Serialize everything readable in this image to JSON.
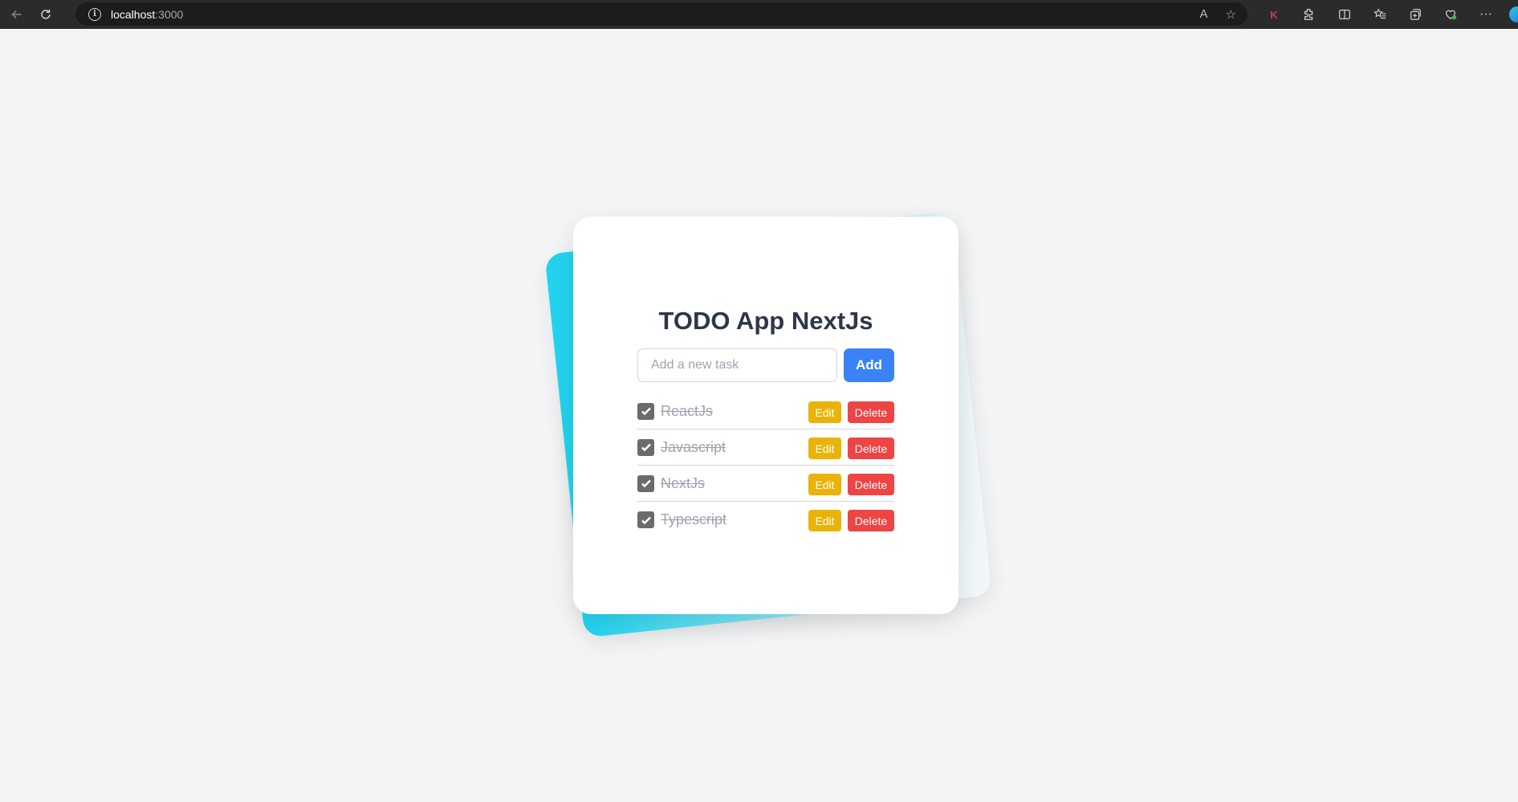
{
  "browser": {
    "url_host": "localhost",
    "url_port": ":3000",
    "toolbar_k_label": "K"
  },
  "app": {
    "title": "TODO App NextJs",
    "input": {
      "placeholder": "Add a new task",
      "value": ""
    },
    "add_label": "Add",
    "edit_label": "Edit",
    "delete_label": "Delete",
    "tasks": [
      {
        "text": "ReactJs",
        "completed": true
      },
      {
        "text": "Javascript",
        "completed": true
      },
      {
        "text": "NextJs",
        "completed": true
      },
      {
        "text": "Typescript",
        "completed": true
      }
    ]
  },
  "colors": {
    "page_bg": "#f3f4f6",
    "accent_cyan": "#22d3ee",
    "add_button": "#3b82f6",
    "edit_button": "#eab308",
    "delete_button": "#ef4444",
    "title": "#2d3748"
  }
}
